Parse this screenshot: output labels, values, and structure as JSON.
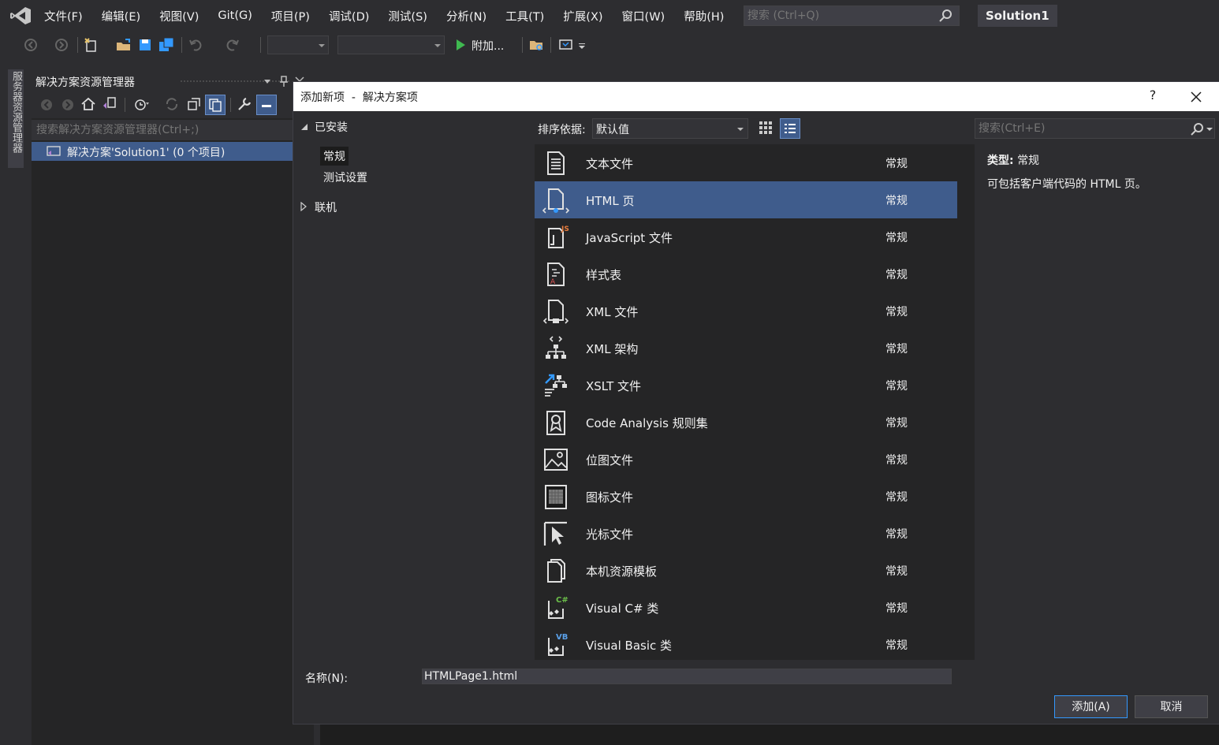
{
  "menubar": {
    "items": [
      "文件(F)",
      "编辑(E)",
      "视图(V)",
      "Git(G)",
      "项目(P)",
      "调试(D)",
      "测试(S)",
      "分析(N)",
      "工具(T)",
      "扩展(X)",
      "窗口(W)",
      "帮助(H)"
    ],
    "search_placeholder": "搜索 (Ctrl+Q)",
    "solution_name": "Solution1"
  },
  "toolbar": {
    "attach_label": "附加...",
    "icons": [
      "back-icon",
      "forward-icon",
      "new-project-icon",
      "open-icon",
      "save-icon",
      "save-all-icon",
      "undo-icon",
      "redo-icon",
      "play-icon",
      "find-in-files-icon",
      "solution-explorer-icon"
    ]
  },
  "server_tab": {
    "label": "服务器资源管理器"
  },
  "solution_explorer": {
    "title": "解决方案资源管理器",
    "search_placeholder": "搜索解决方案资源管理器(Ctrl+;)",
    "tree_item": "解决方案'Solution1' (0 个项目)"
  },
  "dialog": {
    "title": "添加新项  -  解决方案项",
    "help": "?",
    "tree": {
      "installed": "已安装",
      "general": "常规",
      "test_settings": "测试设置",
      "online": "联机"
    },
    "sort_label": "排序依据:",
    "sort_value": "默认值",
    "search_placeholder": "搜索(Ctrl+E)",
    "templates": [
      {
        "name": "文本文件",
        "category": "常规",
        "icon": "text-file-icon"
      },
      {
        "name": "HTML 页",
        "category": "常规",
        "icon": "html-page-icon",
        "selected": true
      },
      {
        "name": "JavaScript 文件",
        "category": "常规",
        "icon": "javascript-file-icon"
      },
      {
        "name": "样式表",
        "category": "常规",
        "icon": "stylesheet-icon"
      },
      {
        "name": "XML 文件",
        "category": "常规",
        "icon": "xml-file-icon"
      },
      {
        "name": "XML 架构",
        "category": "常规",
        "icon": "xml-schema-icon"
      },
      {
        "name": "XSLT 文件",
        "category": "常规",
        "icon": "xslt-file-icon"
      },
      {
        "name": "Code Analysis 规则集",
        "category": "常规",
        "icon": "code-analysis-icon"
      },
      {
        "name": "位图文件",
        "category": "常规",
        "icon": "bitmap-file-icon"
      },
      {
        "name": "图标文件",
        "category": "常规",
        "icon": "icon-file-icon"
      },
      {
        "name": "光标文件",
        "category": "常规",
        "icon": "cursor-file-icon"
      },
      {
        "name": "本机资源模板",
        "category": "常规",
        "icon": "native-resource-icon"
      },
      {
        "name": "Visual C# 类",
        "category": "常规",
        "icon": "csharp-class-icon"
      },
      {
        "name": "Visual Basic 类",
        "category": "常规",
        "icon": "vb-class-icon"
      }
    ],
    "details": {
      "type_label": "类型:",
      "type_value": "常规",
      "description": "可包括客户端代码的 HTML 页。"
    },
    "name_label": "名称(N):",
    "name_value": "HTMLPage1.html",
    "add_button": "添加(A)",
    "cancel_button": "取消"
  },
  "colors": {
    "background": "#2d2d30",
    "selection": "#3f5c8c",
    "accent": "#3399ff"
  }
}
